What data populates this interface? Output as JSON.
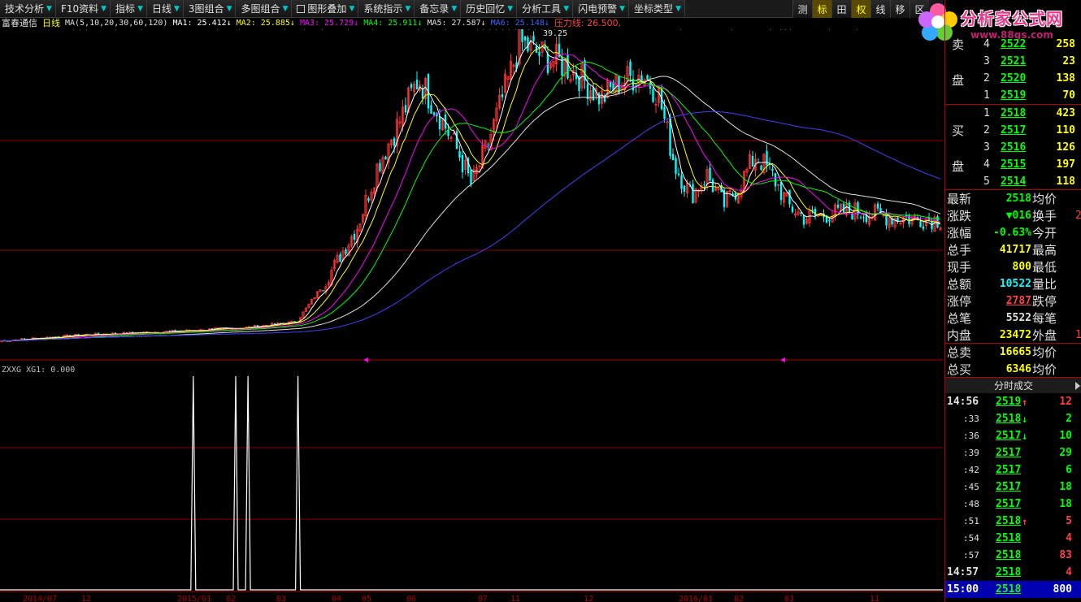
{
  "toolbar": {
    "items": [
      {
        "label": "技术分析"
      },
      {
        "label": "F10资料"
      },
      {
        "label": "指标"
      },
      {
        "label": "日线"
      },
      {
        "label": "3图组合"
      },
      {
        "label": "多图组合"
      },
      {
        "label": "图形叠加"
      },
      {
        "label": "系统指示"
      },
      {
        "label": "备忘录"
      },
      {
        "label": "历史回忆"
      },
      {
        "label": "分析工具"
      },
      {
        "label": "闪电预警"
      },
      {
        "label": "坐标类型"
      }
    ],
    "right_buttons": [
      {
        "label": "测",
        "active": false
      },
      {
        "label": "标",
        "active": true
      },
      {
        "label": "田",
        "active": false
      },
      {
        "label": "权",
        "active": true
      },
      {
        "label": "线",
        "active": false
      },
      {
        "label": "移",
        "active": false
      },
      {
        "label": "区",
        "active": false
      }
    ]
  },
  "logo": {
    "title": "分析家公式网",
    "url": "www.88gs.com"
  },
  "ma_line": {
    "stock_name": "富春通信",
    "period": "日线",
    "ma_params": "MA(5,10,20,30,60,120)",
    "ma1": "MA1: 25.412↓",
    "ma2": "MA2: 25.885↓",
    "ma3": "MA3: 25.729↓",
    "ma4": "MA4: 25.911↓",
    "ma5": "MA5: 27.587↓",
    "ma6": "MA6: 25.148↓",
    "pressure": "压力线: 26.500,"
  },
  "colors": {
    "up": "#ff3232",
    "down": "#00ffff",
    "ma1": "#ffffff",
    "ma2": "#ffff00",
    "ma3": "#ff00ff",
    "ma4": "#00ff00",
    "ma5": "#e0e0e0",
    "ma6": "#4040ff",
    "pressure": "#ff4040",
    "grid": "#8b0000"
  },
  "chart": {
    "peak_label": "39.25",
    "indicator_label": "ZXXG  XG1: 0.000",
    "x_axis_labels": [
      "2014/07",
      "12",
      "2015/01",
      "02",
      "03",
      "04",
      "05",
      "06",
      "07",
      "11",
      "12",
      "2016/01",
      "02",
      "03",
      "11"
    ]
  },
  "chart_data": {
    "type": "line",
    "title": "",
    "series": [
      {
        "name": "MA1",
        "values": []
      },
      {
        "name": "MA2",
        "values": []
      },
      {
        "name": "MA3",
        "values": []
      },
      {
        "name": "MA4",
        "values": []
      },
      {
        "name": "MA5",
        "values": []
      },
      {
        "name": "MA6",
        "values": []
      }
    ],
    "ylim": [
      10,
      40
    ],
    "indicator_signals_x": [
      0.205,
      0.25,
      0.263,
      0.316
    ]
  },
  "order_book": {
    "sell_label": [
      "卖",
      "盘"
    ],
    "buy_label": [
      "买",
      "盘"
    ],
    "sell": [
      {
        "level": "4",
        "price": "2522",
        "vol": "258"
      },
      {
        "level": "3",
        "price": "2521",
        "vol": "23"
      },
      {
        "level": "2",
        "price": "2520",
        "vol": "138"
      },
      {
        "level": "1",
        "price": "2519",
        "vol": "70"
      }
    ],
    "buy": [
      {
        "level": "1",
        "price": "2518",
        "vol": "423"
      },
      {
        "level": "2",
        "price": "2517",
        "vol": "110"
      },
      {
        "level": "3",
        "price": "2516",
        "vol": "126"
      },
      {
        "level": "4",
        "price": "2515",
        "vol": "197"
      },
      {
        "level": "5",
        "price": "2514",
        "vol": "118"
      }
    ]
  },
  "quote": [
    {
      "label": "最新",
      "value": "2518",
      "color": "#00ff00",
      "label2": "均价",
      "value2": ""
    },
    {
      "label": "涨跌",
      "value": "▼016",
      "color": "#00ff00",
      "label2": "换手",
      "value2": "2"
    },
    {
      "label": "涨幅",
      "value": "-0.63%",
      "color": "#00ff00",
      "label2": "今开",
      "value2": ""
    },
    {
      "label": "总手",
      "value": "41717",
      "color": "#ffff00",
      "label2": "最高",
      "value2": ""
    },
    {
      "label": "现手",
      "value": "800",
      "color": "#ffff00",
      "label2": "最低",
      "value2": ""
    },
    {
      "label": "总额",
      "value": "10522",
      "color": "#00ffff",
      "label2": "量比",
      "value2": ""
    },
    {
      "label": "涨停",
      "value": "2787",
      "color": "#ff4040",
      "label2": "跌停",
      "value2": ""
    },
    {
      "label": "总笔",
      "value": "5522",
      "color": "#e0e0e0",
      "label2": "每笔",
      "value2": ""
    },
    {
      "label": "内盘",
      "value": "23472",
      "color": "#ffff00",
      "label2": "外盘",
      "value2": "1"
    },
    {
      "label": "总卖",
      "value": "16665",
      "color": "#ffff00",
      "label2": "均价",
      "value2": ""
    },
    {
      "label": "总买",
      "value": "6346",
      "color": "#ffff00",
      "label2": "均价",
      "value2": ""
    }
  ],
  "ticks": {
    "header": "分时成交",
    "rows": [
      {
        "time": "14:56",
        "price": "2519",
        "dir": "up",
        "vol": "12",
        "vcolor": "#ff4040"
      },
      {
        "time": ":33",
        "price": "2518",
        "dir": "down",
        "vol": "2",
        "vcolor": "#00ff00"
      },
      {
        "time": ":36",
        "price": "2517",
        "dir": "down",
        "vol": "10",
        "vcolor": "#00ff00"
      },
      {
        "time": ":39",
        "price": "2517",
        "dir": "",
        "vol": "29",
        "vcolor": "#00ff00"
      },
      {
        "time": ":42",
        "price": "2517",
        "dir": "",
        "vol": "6",
        "vcolor": "#00ff00"
      },
      {
        "time": ":45",
        "price": "2517",
        "dir": "",
        "vol": "18",
        "vcolor": "#00ff00"
      },
      {
        "time": ":48",
        "price": "2517",
        "dir": "",
        "vol": "18",
        "vcolor": "#00ff00"
      },
      {
        "time": ":51",
        "price": "2518",
        "dir": "up",
        "vol": "5",
        "vcolor": "#ff4040"
      },
      {
        "time": ":54",
        "price": "2518",
        "dir": "",
        "vol": "4",
        "vcolor": "#ff4040"
      },
      {
        "time": ":57",
        "price": "2518",
        "dir": "",
        "vol": "83",
        "vcolor": "#ff4040"
      },
      {
        "time": "14:57",
        "price": "2518",
        "dir": "",
        "vol": "4",
        "vcolor": "#ff4040"
      },
      {
        "time": "15:00",
        "price": "2518",
        "dir": "",
        "vol": "800",
        "vcolor": "#ffffff"
      }
    ]
  }
}
